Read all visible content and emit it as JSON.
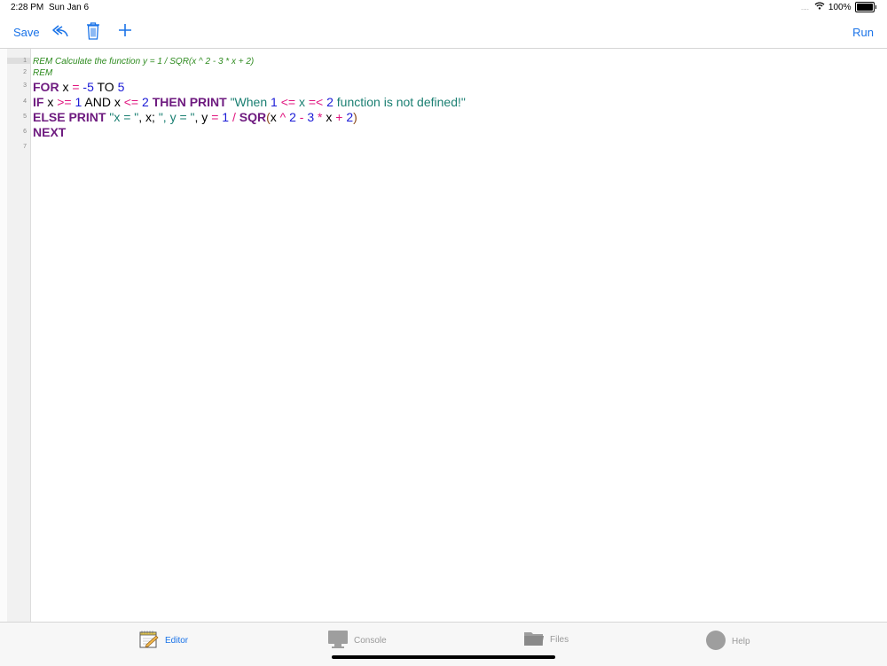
{
  "status": {
    "time": "2:28 PM",
    "date": "Sun Jan 6",
    "battery": "100%",
    "signal_dots": "....",
    "icons": [
      "wifi-icon",
      "battery-icon"
    ]
  },
  "toolbar": {
    "save_label": "Save",
    "run_label": "Run",
    "icons": [
      "undo-icon",
      "trash-icon",
      "plus-icon"
    ]
  },
  "editor": {
    "line_numbers": [
      "1",
      "2",
      "3",
      "4",
      "5",
      "6",
      "7"
    ],
    "lines": [
      "REM Calculate the function y = 1 / SQR(x ^ 2 - 3 * x + 2)",
      "REM",
      "FOR x = -5 TO 5",
      "IF x >= 1 AND x <= 2 THEN PRINT \"When 1 <= x =< 2 function is not defined!\"",
      "ELSE PRINT \"x = \", x; \", y = \", y = 1 / SQR(x ^ 2 - 3 * x + 2)",
      "NEXT",
      ""
    ],
    "tokens": {
      "l1": "REM Calculate the function y = 1 / SQR(x ^ 2 - 3 * x + 2)",
      "l2": "REM",
      "l3": [
        "FOR",
        " x ",
        "=",
        " ",
        "-5",
        " TO ",
        "5"
      ],
      "l4": [
        "IF",
        " x ",
        ">=",
        " ",
        "1",
        " AND x ",
        "<=",
        " ",
        "2",
        " ",
        "THEN PRINT",
        " ",
        "\"When ",
        "1",
        " ",
        "<=",
        " x ",
        "=<",
        " ",
        "2",
        " function is not defined!\""
      ],
      "l5": [
        "ELSE PRINT",
        " ",
        "\"x = \"",
        ", x; ",
        "\", y = \"",
        ", y ",
        "=",
        " ",
        "1",
        " ",
        "/",
        " ",
        "SQR",
        "(",
        "x ",
        "^",
        " ",
        "2",
        " ",
        "-",
        " ",
        "3",
        " ",
        "*",
        " x ",
        "+",
        " ",
        "2",
        ")"
      ],
      "l6": "NEXT"
    }
  },
  "tabs": [
    {
      "label": "Editor",
      "icon": "editor-notepad-icon",
      "active": true
    },
    {
      "label": "Console",
      "icon": "console-monitor-icon",
      "active": false
    },
    {
      "label": "Files",
      "icon": "folder-icon",
      "active": false
    },
    {
      "label": "Help",
      "icon": "help-circle-icon",
      "active": false
    }
  ]
}
